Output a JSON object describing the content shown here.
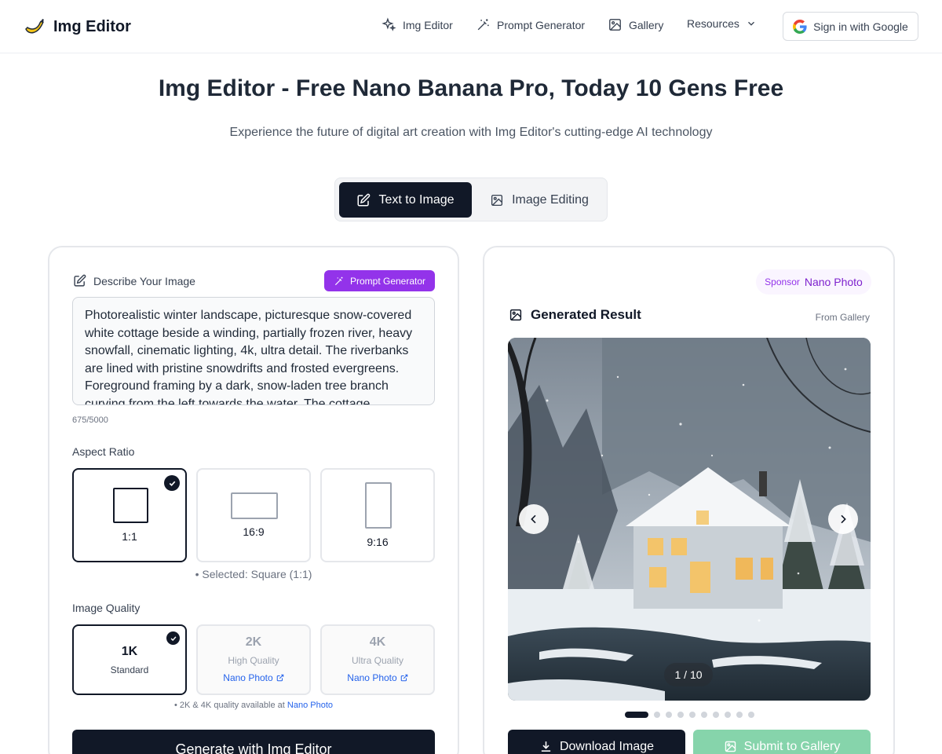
{
  "header": {
    "brand": "Img Editor",
    "nav": {
      "img_editor": "Img Editor",
      "prompt_generator": "Prompt Generator",
      "gallery": "Gallery",
      "resources": "Resources"
    },
    "signin": "Sign in with Google"
  },
  "hero": {
    "title": "Img Editor - Free Nano Banana Pro, Today 10 Gens Free",
    "subtitle": "Experience the future of digital art creation with Img Editor's cutting-edge AI technology"
  },
  "mode_tabs": {
    "text_to_image": "Text to Image",
    "image_editing": "Image Editing",
    "active": "text_to_image"
  },
  "left_panel": {
    "describe_label": "Describe Your Image",
    "prompt_generator_btn": "Prompt Generator",
    "prompt_text": "Photorealistic winter landscape, picturesque snow-covered white cottage beside a winding, partially frozen river, heavy snowfall, cinematic lighting, 4k, ultra detail. The riverbanks are lined with pristine snowdrifts and frosted evergreens. Foreground framing by a dark, snow-laden tree branch curving from the left towards the water. The cottage",
    "char_count": "675/5000",
    "aspect_label": "Aspect Ratio",
    "aspect_options": [
      "1:1",
      "16:9",
      "9:16"
    ],
    "aspect_selected": "1:1",
    "aspect_note": "• Selected: Square (1:1)",
    "quality_label": "Image Quality",
    "quality_options": [
      {
        "title": "1K",
        "sub": "Standard",
        "link": ""
      },
      {
        "title": "2K",
        "sub": "High Quality",
        "link": "Nano Photo"
      },
      {
        "title": "4K",
        "sub": "Ultra Quality",
        "link": "Nano Photo"
      }
    ],
    "quality_selected": "1K",
    "quality_note_prefix": "• 2K & 4K quality available at ",
    "quality_note_link": "Nano Photo",
    "generate_btn": "Generate with Img Editor"
  },
  "right_panel": {
    "sponsor_tag": "Sponsor",
    "sponsor_name": "Nano Photo",
    "result_title": "Generated Result",
    "from_gallery": "From Gallery",
    "counter": "1 / 10",
    "current_index": 1,
    "total": 10,
    "download_btn": "Download Image",
    "submit_btn": "Submit to Gallery"
  },
  "colors": {
    "primary": "#111827",
    "accent_purple": "#9333ea",
    "link_blue": "#2563eb",
    "submit_green": "#86d4ab"
  }
}
